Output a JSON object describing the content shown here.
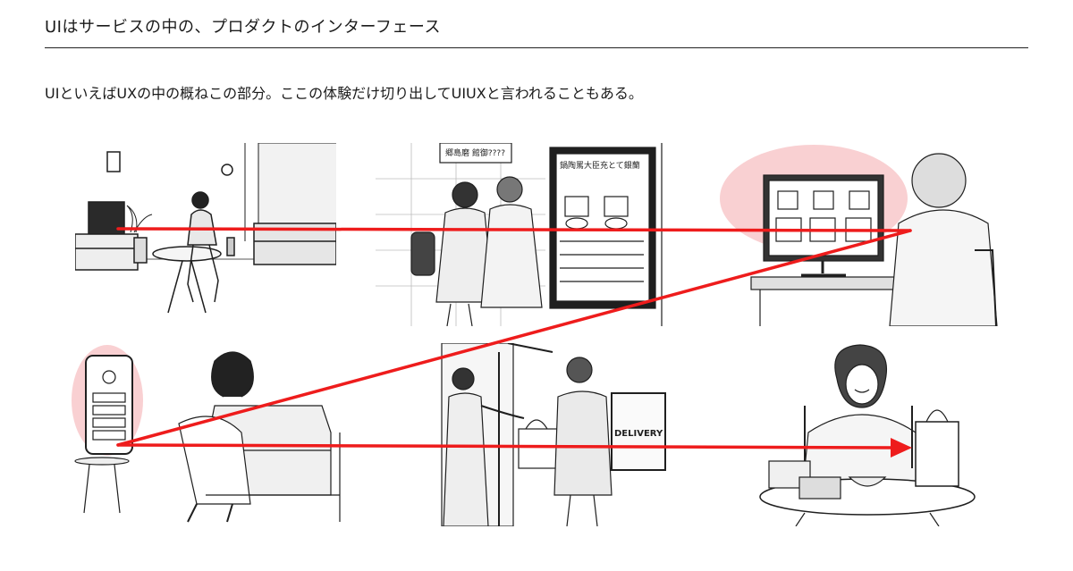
{
  "header": {
    "title": "UIはサービスの中の、プロダクトのインターフェース",
    "subtitle": "UIといえばUXの中の概ねこの部分。ここの体験だけ切り出してUIUXと言われることもある。"
  },
  "illustrations": {
    "delivery_bag_text": "DELIVERY",
    "sign_text": "郷島磨 館御????",
    "kiosk_headline": "鍋陶罵大臣充とて銀蘭"
  },
  "colors": {
    "arrow": "#ee1c1c",
    "highlight": "#f4a9ad",
    "line_art": "#1f1f1f"
  }
}
